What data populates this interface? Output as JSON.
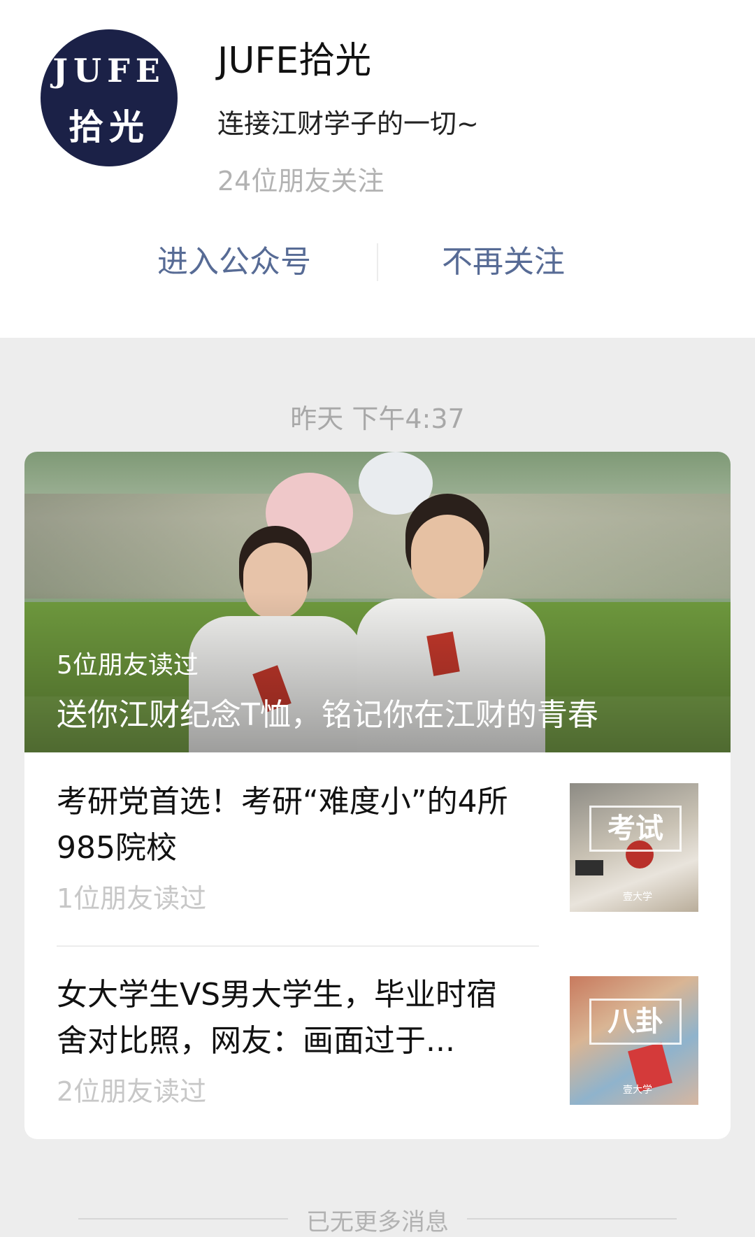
{
  "account": {
    "avatar_line1": "JUFE",
    "avatar_line2": "拾光",
    "name": "JUFE拾光",
    "description": "连接江财学子的一切~",
    "friends_following": "24位朋友关注"
  },
  "actions": {
    "enter_label": "进入公众号",
    "unfollow_label": "不再关注"
  },
  "timestamp": "昨天 下午4:37",
  "hero_article": {
    "read_by": "5位朋友读过",
    "title": "送你江财纪念T恤，铭记你在江财的青春"
  },
  "articles": [
    {
      "title": "考研党首选！考研“难度小”的4所985院校",
      "read_by": "1位朋友读过",
      "thumb_tag": "考试",
      "thumb_logo": "壹大学"
    },
    {
      "title": "女大学生VS男大学生，毕业时宿舍对比照，网友：画面过于...",
      "read_by": "2位朋友读过",
      "thumb_tag": "八卦",
      "thumb_logo": "壹大学"
    }
  ],
  "footer": "已无更多消息",
  "colors": {
    "link": "#576b95",
    "background": "#ededed",
    "avatar_bg": "#1b2147"
  },
  "icons": {
    "avatar": "account-logo"
  }
}
